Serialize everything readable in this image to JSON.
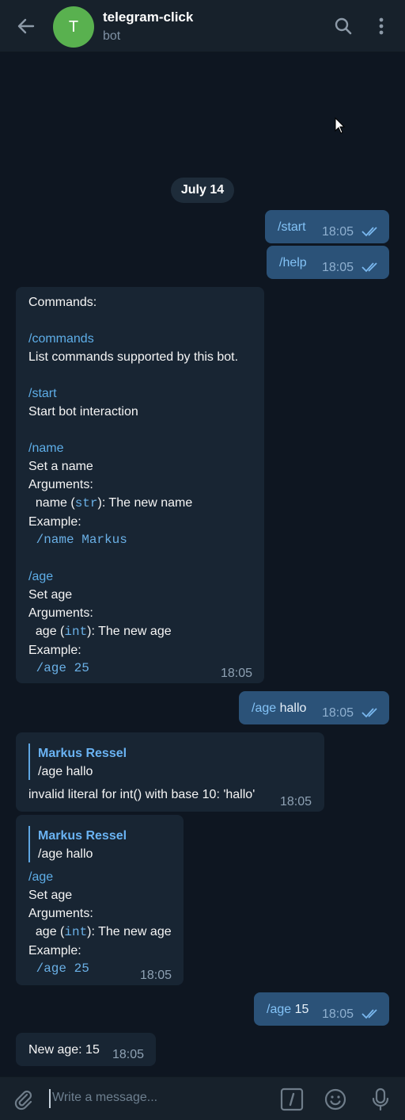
{
  "header": {
    "avatar_letter": "T",
    "title": "telegram-click",
    "subtitle": "bot"
  },
  "date_label": "July 14",
  "messages": {
    "m1": {
      "text": "/start",
      "time": "18:05"
    },
    "m2": {
      "text": "/help",
      "time": "18:05"
    },
    "m3": {
      "l1": "Commands:",
      "l2": "/commands",
      "l3": "List commands supported by this bot.",
      "l4": "/start",
      "l5": "Start bot interaction",
      "l6": "/name",
      "l7": "Set a name",
      "l8": "Arguments:",
      "l9a": "  name (",
      "l9b": "str",
      "l9c": "): The new name",
      "l10": "Example:",
      "l11": " /name Markus",
      "l12": "/age",
      "l13": "Set age",
      "l14": "Arguments:",
      "l15a": "  age (",
      "l15b": "int",
      "l15c": "): The new age",
      "l16": "Example:",
      "l17": " /age 25",
      "time": "18:05"
    },
    "m4": {
      "cmd": "/age",
      "rest": " hallo",
      "time": "18:05"
    },
    "m5": {
      "reply_name": "Markus Ressel",
      "reply_text": "/age hallo",
      "text": "invalid literal for int() with base 10: 'hallo'",
      "time": "18:05"
    },
    "m6": {
      "reply_name": "Markus Ressel",
      "reply_text": "/age hallo",
      "l1": "/age",
      "l2": "Set age",
      "l3": "Arguments:",
      "l4a": "  age (",
      "l4b": "int",
      "l4c": "): The new age",
      "l5": "Example:",
      "l6": " /age 25",
      "time": "18:05"
    },
    "m7": {
      "cmd": "/age",
      "rest": " 15",
      "time": "18:05"
    },
    "m8": {
      "text": "New age: 15",
      "time": "18:05"
    }
  },
  "composer": {
    "placeholder": "Write a message..."
  },
  "colors": {
    "background": "#0e1621",
    "header": "#17212b",
    "outgoing": "#2b5278",
    "incoming": "#182533",
    "accent": "#5eaee8"
  }
}
